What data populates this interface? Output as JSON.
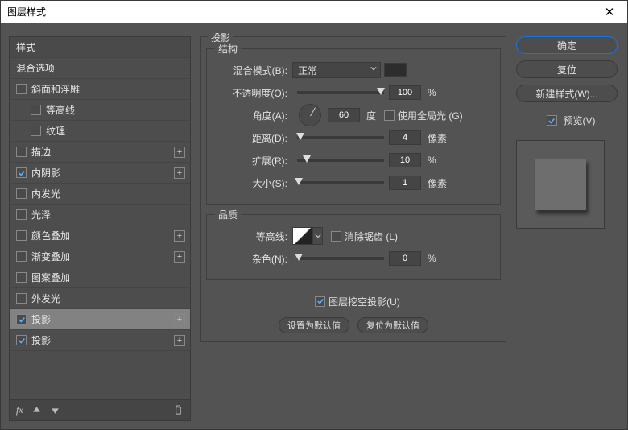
{
  "window": {
    "title": "图层样式"
  },
  "sidebar": {
    "header": "样式",
    "blendOptions": "混合选项",
    "items": [
      {
        "label": "斜面和浮雕",
        "checked": false,
        "fx": false,
        "indent": 0
      },
      {
        "label": "等高线",
        "checked": false,
        "fx": false,
        "indent": 1
      },
      {
        "label": "纹理",
        "checked": false,
        "fx": false,
        "indent": 1
      },
      {
        "label": "描边",
        "checked": false,
        "fx": true,
        "indent": 0
      },
      {
        "label": "内阴影",
        "checked": true,
        "fx": true,
        "indent": 0
      },
      {
        "label": "内发光",
        "checked": false,
        "fx": false,
        "indent": 0
      },
      {
        "label": "光泽",
        "checked": false,
        "fx": false,
        "indent": 0
      },
      {
        "label": "颜色叠加",
        "checked": false,
        "fx": true,
        "indent": 0
      },
      {
        "label": "渐变叠加",
        "checked": false,
        "fx": true,
        "indent": 0
      },
      {
        "label": "图案叠加",
        "checked": false,
        "fx": false,
        "indent": 0
      },
      {
        "label": "外发光",
        "checked": false,
        "fx": false,
        "indent": 0
      },
      {
        "label": "投影",
        "checked": true,
        "fx": true,
        "indent": 0,
        "selected": true
      },
      {
        "label": "投影",
        "checked": true,
        "fx": true,
        "indent": 0
      }
    ],
    "footerFx": "fx"
  },
  "main": {
    "title": "投影",
    "structure": {
      "legend": "结构",
      "blendModeLabel": "混合模式(B):",
      "blendModeValue": "正常",
      "opacityLabel": "不透明度(O):",
      "opacityValue": "100",
      "opacityUnit": "%",
      "angleLabel": "角度(A):",
      "angleValue": "60",
      "angleUnit": "度",
      "globalLightLabel": "使用全局光 (G)",
      "distanceLabel": "距离(D):",
      "distanceValue": "4",
      "distanceUnit": "像素",
      "spreadLabel": "扩展(R):",
      "spreadValue": "10",
      "spreadUnit": "%",
      "sizeLabel": "大小(S):",
      "sizeValue": "1",
      "sizeUnit": "像素"
    },
    "quality": {
      "legend": "品质",
      "contourLabel": "等高线:",
      "antiAliasLabel": "消除锯齿 (L)",
      "noiseLabel": "杂色(N):",
      "noiseValue": "0",
      "noiseUnit": "%"
    },
    "knockoutLabel": "图层挖空投影(U)",
    "btnDefault": "设置为默认值",
    "btnReset": "复位为默认值"
  },
  "right": {
    "ok": "确定",
    "cancel": "复位",
    "newStyle": "新建样式(W)...",
    "preview": "预览(V)"
  }
}
